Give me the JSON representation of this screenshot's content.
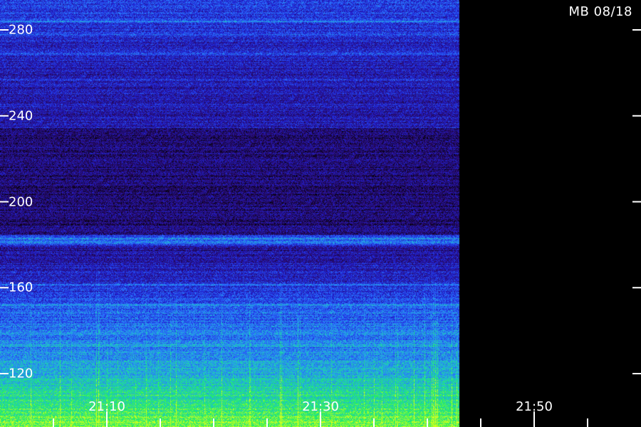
{
  "chart_data": {
    "type": "heatmap",
    "title": "MB 08/18",
    "xlabel": "",
    "ylabel": "",
    "x_tick_labels": [
      "21:10",
      "21:30",
      "21:50"
    ],
    "x_tick_times": [
      "21:10",
      "21:30",
      "21:50"
    ],
    "x_range": [
      "21:00",
      "22:00"
    ],
    "y_tick_labels": [
      "120",
      "160",
      "200",
      "240",
      "280"
    ],
    "y_tick_values": [
      120,
      160,
      200,
      240,
      280
    ],
    "y_range": [
      105,
      293
    ],
    "data_end_time": "21:43",
    "colormap": [
      "#000000",
      "#2a0a6a",
      "#2020d0",
      "#2a70ff",
      "#20c0d0",
      "#20f060",
      "#d0ff20"
    ],
    "grid": false,
    "legend": "none"
  }
}
